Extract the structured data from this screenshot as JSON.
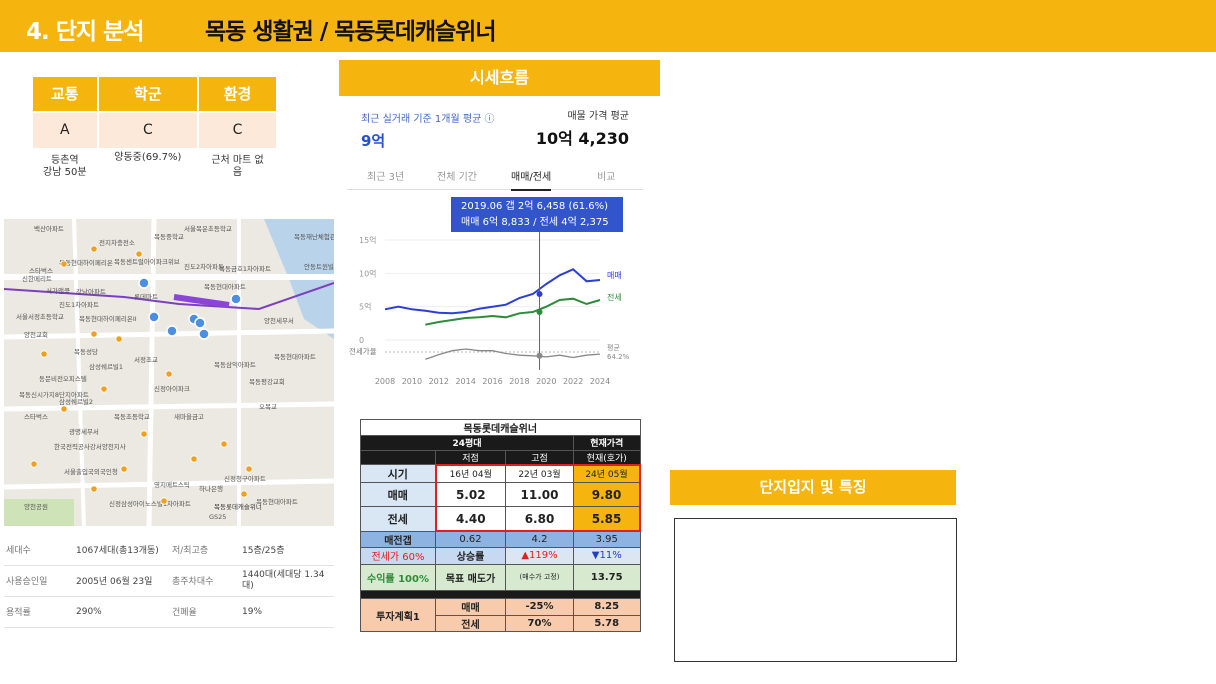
{
  "header": {
    "section_number": "4. 단지 분석",
    "title": "목동 생활권 / 목동롯데캐슬위너"
  },
  "ratings": {
    "headers": [
      "교통",
      "학군",
      "환경"
    ],
    "grades": [
      "A",
      "C",
      "C"
    ],
    "notes": [
      [
        "등촌역",
        "강남 50분"
      ],
      [
        "양동중(69.7%)",
        ""
      ],
      [
        "근처 마트 없",
        "음"
      ]
    ]
  },
  "map": {
    "labels": [
      "백산아파트",
      "전지차충전소",
      "목동중학교",
      "서울목운초등학교",
      "목동재난체험관",
      "스타벅스",
      "목동현대하이페리온",
      "목동센트럴아이파크위브",
      "진도2차아파트",
      "목동금호1차아파트",
      "신한메리트",
      "서가앤쿡",
      "강남아파트",
      "진도1차아파트",
      "롯데마트",
      "목동현대아파트",
      "안동트윈빌",
      "서울서정초등학교",
      "목동현대하이페리온II",
      "양천세무서",
      "양천교회",
      "목동성당",
      "서정초교",
      "삼성쉐르빌1",
      "목동삼익아파트",
      "목동현대아파트",
      "동문비전오피스텔",
      "신정아이파크",
      "목동평강교회",
      "목동신시가지8단지아파트",
      "삼성쉐르빌2",
      "스타벅스",
      "목동초등학교",
      "새마을금고",
      "오목교",
      "광명세무서",
      "한국전력공사강서양천지사",
      "서울출입국외국인청",
      "영지메트스틱",
      "하나은행",
      "목동롯데캐슬위너",
      "신정청구아파트",
      "신정삼성아이노스빌1차아파트",
      "목동현대아파트",
      "양천공원",
      "GS25"
    ],
    "station_marker": "등촌역"
  },
  "info": {
    "rows": [
      {
        "k1": "세대수",
        "v1": "1067세대(총13개동)",
        "k2": "저/최고층",
        "v2": "15층/25층"
      },
      {
        "k1": "사용승인일",
        "v1": "2005년 06월 23일",
        "k2": "총주차대수",
        "v2": "1440대(세대당 1.34대)"
      },
      {
        "k1": "용적률",
        "v1": "290%",
        "k2": "건폐율",
        "v2": "19%"
      }
    ]
  },
  "trend": {
    "header": "시세흐름",
    "recent_label": "최근 실거래 기준 1개월 평균 ⓘ",
    "recent_value": "9억",
    "avg_label": "매물 가격 평균",
    "avg_value": "10억 4,230",
    "tabs": [
      "최근 3년",
      "전체 기간",
      "매매/전세",
      "비교"
    ],
    "active_tab": "매매/전세",
    "tooltip_line1": "2019.06  갭 2억 6,458 (61.6%)",
    "tooltip_line2": "매매 6억 8,833 / 전세 4억 2,375",
    "legend_sale": "매매",
    "legend_jeonse": "전세",
    "legend_ratio": "평균",
    "legend_ratio_val": "64.2%",
    "ratio_label": "전세가율"
  },
  "chart_data": {
    "type": "line",
    "x": [
      2008,
      2009,
      2010,
      2011,
      2012,
      2013,
      2014,
      2015,
      2016,
      2017,
      2018,
      2019,
      2020,
      2021,
      2022,
      2023,
      2024
    ],
    "x_ticks": [
      "2008",
      "2010",
      "2012",
      "2014",
      "2016",
      "2018",
      "2020",
      "2022",
      "2024"
    ],
    "y_ticks": [
      "15억",
      "10억",
      "5억",
      "0"
    ],
    "ylim": [
      0,
      15
    ],
    "series": [
      {
        "name": "매매",
        "color": "#2b3fd6",
        "values": [
          4.6,
          5.0,
          4.6,
          4.4,
          4.1,
          4.0,
          4.2,
          4.7,
          5.0,
          5.3,
          6.3,
          6.9,
          8.4,
          9.7,
          10.6,
          8.8,
          9.0
        ]
      },
      {
        "name": "전세",
        "color": "#2e8b3a",
        "values": [
          null,
          null,
          null,
          2.3,
          2.7,
          3.0,
          3.3,
          3.4,
          3.6,
          3.4,
          4.0,
          4.2,
          5.0,
          6.0,
          6.2,
          5.4,
          6.0
        ]
      },
      {
        "name": "평균",
        "color": "#888888",
        "values": [
          null,
          null,
          null,
          55,
          63,
          70,
          73,
          70,
          70,
          65,
          62,
          61,
          59,
          62,
          58,
          62,
          64
        ]
      }
    ],
    "tooltip_x": 2019.5
  },
  "price_table": {
    "title": "목동롯데캐슬위너",
    "size": "24평대",
    "current_label": "현재가격",
    "col_low": "저점",
    "col_high": "고점",
    "col_now": "현재(호가)",
    "row_time": {
      "label": "시기",
      "low": "16년 04월",
      "high": "22년 03월",
      "now": "24년 05월"
    },
    "row_sale": {
      "label": "매매",
      "low": "5.02",
      "high": "11.00",
      "now": "9.80"
    },
    "row_jeonse": {
      "label": "전세",
      "low": "4.40",
      "high": "6.80",
      "now": "5.85"
    },
    "row_gap": {
      "label": "매전갭",
      "low": "0.62",
      "high": "4.2",
      "now": "3.95"
    },
    "row_ratio": {
      "label": "전세가 60%",
      "label2": "상승률",
      "high": "▲119%",
      "now": "▼11%"
    },
    "row_return": {
      "label": "수익률 100%",
      "label2": "목표 매도가",
      "note": "(매수가 고정)",
      "now": "13.75"
    },
    "plan": {
      "label": "투자계획1",
      "r1": "매매",
      "r1v": "-25%",
      "r1n": "8.25",
      "r2": "전세",
      "r2v": "70%",
      "r2n": "5.78"
    }
  },
  "features": {
    "header": "단지입지 및 특징"
  }
}
